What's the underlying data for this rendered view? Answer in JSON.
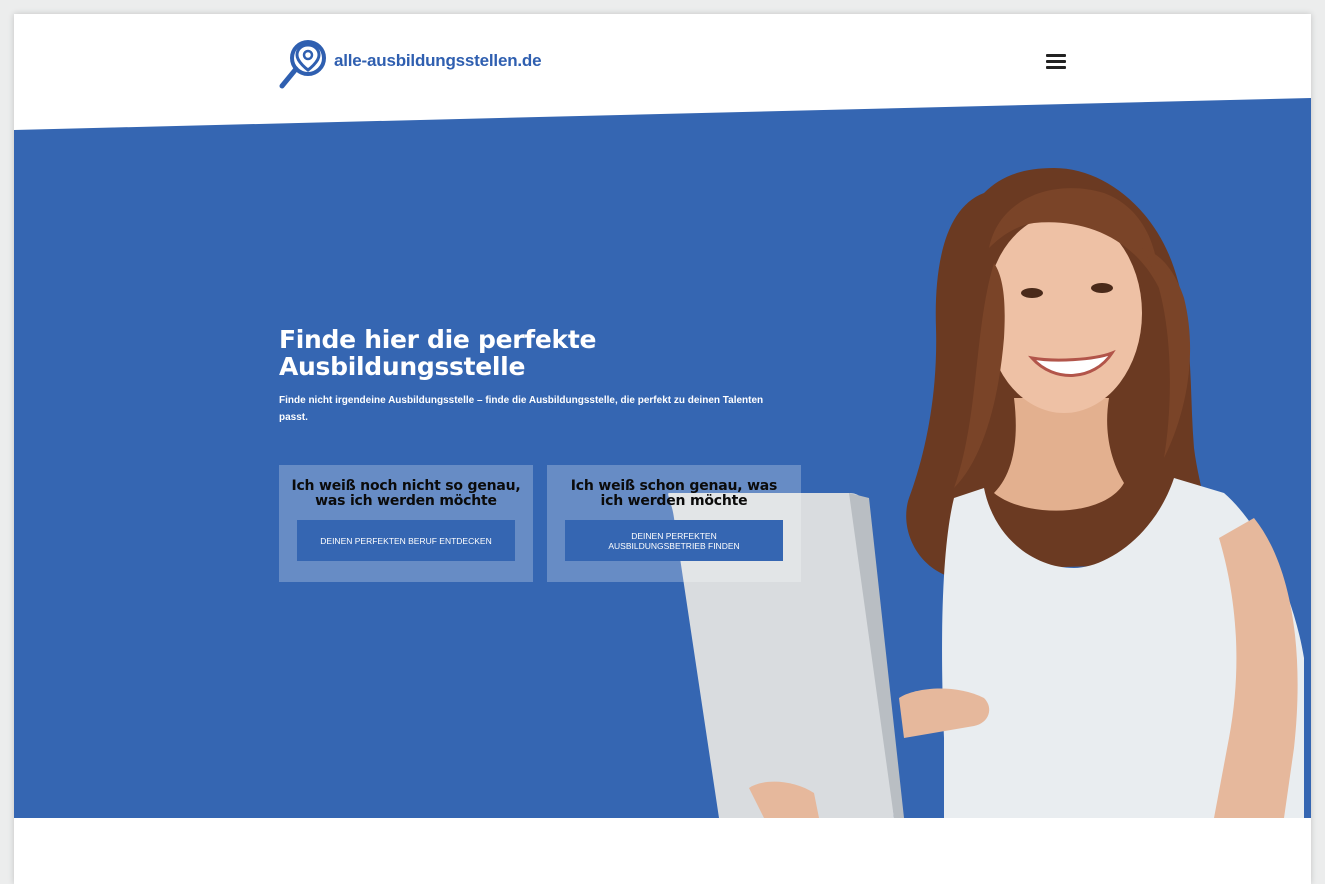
{
  "header": {
    "logo_text": "alle-ausbildungsstellen.de",
    "logo_icon": "magnifier-location-pin-icon",
    "menu_icon": "hamburger-menu-icon"
  },
  "hero": {
    "title": "Finde hier die perfekte Ausbildungsstelle",
    "subtitle": "Finde nicht irgendeine Ausbildungsstelle – finde die Ausbildungsstelle, die perfekt zu deinen Talenten passt.",
    "cards": [
      {
        "title": "Ich weiß noch nicht so genau, was ich werden möchte",
        "button": "DEINEN PERFEKTEN BERUF ENTDECKEN"
      },
      {
        "title": "Ich weiß schon genau, was ich werden möchte",
        "button": "DEINEN PERFEKTEN AUSBILDUNGSBETRIEB FINDEN"
      }
    ]
  },
  "colors": {
    "brand_blue": "#3566b2",
    "logo_blue": "#2f5fb0",
    "background": "#ffffff"
  }
}
